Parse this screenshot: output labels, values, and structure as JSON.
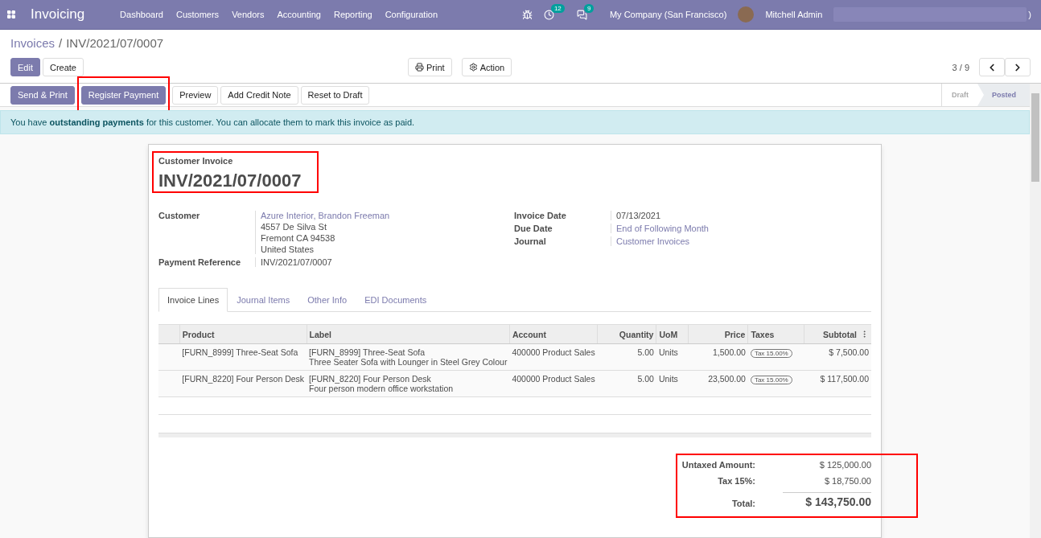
{
  "navbar": {
    "app_name": "Invoicing",
    "menus": [
      "Dashboard",
      "Customers",
      "Vendors",
      "Accounting",
      "Reporting",
      "Configuration"
    ],
    "activity_count": "12",
    "message_count": "9",
    "company": "My Company (San Francisco)",
    "user": "Mitchell Admin",
    "user_suffix": ")"
  },
  "breadcrumb_separator": "/",
  "breadcrumb": [
    {
      "label": "Invoices",
      "kind": "link"
    },
    {
      "label": "INV/2021/07/0007",
      "kind": "current"
    }
  ],
  "main_buttons": [
    {
      "label": "Edit",
      "primary": true
    },
    {
      "label": "Create",
      "primary": false
    }
  ],
  "print_button": "Print",
  "action_button": "Action",
  "pager": "3 / 9",
  "header_buttons": [
    {
      "label": "Send & Print",
      "primary": true,
      "highlighted": false
    },
    {
      "label": "Register Payment",
      "primary": true,
      "highlighted": true
    },
    {
      "label": "Preview",
      "primary": false,
      "highlighted": false
    },
    {
      "label": "Add Credit Note",
      "primary": false,
      "highlighted": false
    },
    {
      "label": "Reset to Draft",
      "primary": false,
      "highlighted": false
    }
  ],
  "status_steps": [
    {
      "label": "Draft",
      "selected": false
    },
    {
      "label": "Posted",
      "selected": true
    }
  ],
  "alert": "You have **outstanding payments** for this customer. You can allocate them to mark this invoice as paid.",
  "invoice": {
    "type_label": "Customer Invoice",
    "number": "INV/2021/07/0007",
    "highlighted": true
  },
  "left_fields": [
    {
      "label": "Customer",
      "values": [
        {
          "text": "Azure Interior, Brandon Freeman",
          "link": true
        },
        {
          "text": "4557 De Silva St",
          "link": false
        },
        {
          "text": "Fremont CA 94538",
          "link": false
        },
        {
          "text": "United States",
          "link": false
        }
      ]
    },
    {
      "label": "Payment Reference",
      "values": [
        {
          "text": "INV/2021/07/0007",
          "link": false
        }
      ]
    }
  ],
  "right_fields": [
    {
      "label": "Invoice Date",
      "values": [
        {
          "text": "07/13/2021",
          "link": false
        }
      ]
    },
    {
      "label": "Due Date",
      "values": [
        {
          "text": "End of Following Month",
          "link": true
        }
      ]
    },
    {
      "label": "Journal",
      "values": [
        {
          "text": "Customer Invoices",
          "link": true
        }
      ]
    }
  ],
  "tabs": [
    {
      "label": "Invoice Lines",
      "selected": true
    },
    {
      "label": "Journal Items",
      "selected": false
    },
    {
      "label": "Other Info",
      "selected": false
    },
    {
      "label": "EDI Documents",
      "selected": false
    }
  ],
  "table": {
    "columns": [
      "Product",
      "Label",
      "Account",
      "Quantity",
      "UoM",
      "Price",
      "Taxes",
      "Subtotal"
    ],
    "rows": [
      {
        "product": "[FURN_8999] Three-Seat Sofa",
        "label_lines": [
          "[FURN_8999] Three-Seat Sofa",
          "Three Seater Sofa with Lounger in Steel Grey Colour"
        ],
        "account": "400000 Product Sales",
        "quantity": "5.00",
        "uom": "Units",
        "price": "1,500.00",
        "tax": "Tax 15.00%",
        "subtotal": "$ 7,500.00"
      },
      {
        "product": "[FURN_8220] Four Person Desk",
        "label_lines": [
          "[FURN_8220] Four Person Desk",
          "Four person modern office workstation"
        ],
        "account": "400000 Product Sales",
        "quantity": "5.00",
        "uom": "Units",
        "price": "23,500.00",
        "tax": "Tax 15.00%",
        "subtotal": "$ 117,500.00"
      }
    ]
  },
  "totals": {
    "highlighted": true,
    "rows": [
      {
        "label": "Untaxed Amount:",
        "value": "$ 125,000.00",
        "kind": "plain"
      },
      {
        "label": "Tax 15%:",
        "value": "$ 18,750.00",
        "kind": "plain"
      },
      {
        "label": "Total:",
        "value": "$ 143,750.00",
        "kind": "total"
      }
    ]
  }
}
